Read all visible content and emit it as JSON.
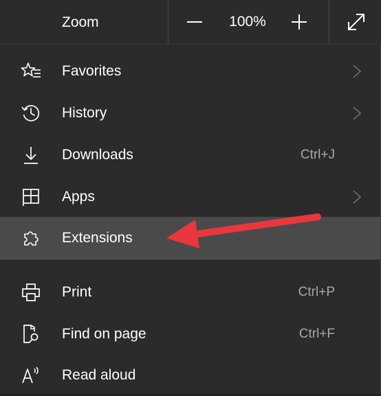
{
  "zoom": {
    "label": "Zoom",
    "value": "100%",
    "decrease_icon": "minus-icon",
    "increase_icon": "plus-icon",
    "fullscreen_icon": "fullscreen-icon"
  },
  "items": [
    {
      "label": "Favorites",
      "shortcut": "",
      "icon": "favorites-star-icon",
      "submenu": true
    },
    {
      "label": "History",
      "shortcut": "",
      "icon": "history-icon",
      "submenu": true
    },
    {
      "label": "Downloads",
      "shortcut": "Ctrl+J",
      "icon": "download-icon",
      "submenu": false
    },
    {
      "label": "Apps",
      "shortcut": "",
      "icon": "apps-icon",
      "submenu": true
    },
    {
      "label": "Extensions",
      "shortcut": "",
      "icon": "puzzle-icon",
      "submenu": false,
      "highlighted": true
    },
    {
      "label": "Print",
      "shortcut": "Ctrl+P",
      "icon": "printer-icon",
      "submenu": false
    },
    {
      "label": "Find on page",
      "shortcut": "Ctrl+F",
      "icon": "find-on-page-icon",
      "submenu": false
    },
    {
      "label": "Read aloud",
      "shortcut": "",
      "icon": "read-aloud-icon",
      "submenu": false
    }
  ],
  "colors": {
    "menu_bg": "#2b2b2b",
    "highlight_bg": "#4a4a4a",
    "text": "#ffffff",
    "shortcut_text": "#a8a8a8",
    "annotation_arrow": "#e8383d"
  }
}
